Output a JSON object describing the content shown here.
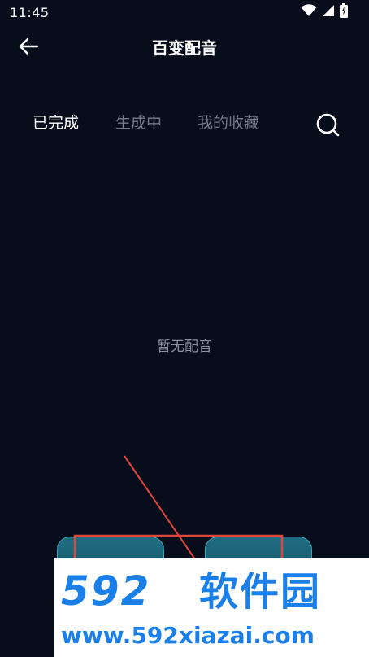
{
  "status_bar": {
    "time": "11:45",
    "icons": [
      "wifi-icon",
      "signal-icon",
      "battery-charging-icon"
    ]
  },
  "header": {
    "title": "百变配音",
    "back_icon": "arrow-left-icon"
  },
  "tabs": [
    {
      "label": "已完成",
      "active": true
    },
    {
      "label": "生成中",
      "active": false
    },
    {
      "label": "我的收藏",
      "active": false
    }
  ],
  "search_icon": "search-icon",
  "empty_state": {
    "text": "暂无配音"
  },
  "watermark": {
    "logo_number": "592",
    "logo_text": "软件园",
    "url": "www.592xiazai.com"
  },
  "colors": {
    "background": "#070d1b",
    "tab_active": "#ffffff",
    "tab_inactive": "#737b8c",
    "empty_text": "#8a91a0",
    "button_teal": "#1f6d82",
    "annotation_red": "#e0473b",
    "watermark_blue": "#1a7fe8"
  }
}
